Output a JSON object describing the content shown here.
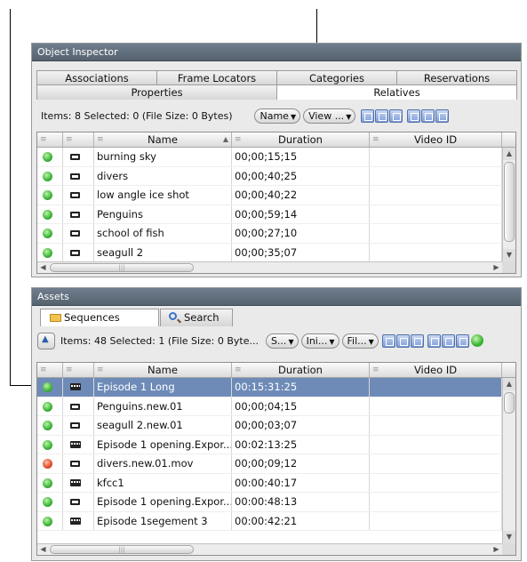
{
  "object_inspector": {
    "title": "Object Inspector",
    "tabs_top": [
      "Associations",
      "Frame Locators",
      "Categories",
      "Reservations"
    ],
    "tabs_bottom": [
      "Properties",
      "Relatives"
    ],
    "active_tab": "Relatives",
    "items_text": "Items: 8 Selected: 0 (File Size: 0 Bytes)",
    "dropdowns": [
      "Name",
      "View ..."
    ],
    "columns": [
      "",
      "",
      "Name",
      "Duration",
      "Video ID"
    ],
    "rows": [
      {
        "status": "green",
        "icon": "clip-icon",
        "name": "burning sky",
        "duration": "00;00;15;15",
        "video_id": ""
      },
      {
        "status": "green",
        "icon": "clip-icon",
        "name": "divers",
        "duration": "00;00;40;25",
        "video_id": ""
      },
      {
        "status": "green",
        "icon": "clip-icon",
        "name": "low angle ice shot",
        "duration": "00;00;40;22",
        "video_id": ""
      },
      {
        "status": "green",
        "icon": "clip-icon",
        "name": "Penguins",
        "duration": "00;00;59;14",
        "video_id": ""
      },
      {
        "status": "green",
        "icon": "clip-icon",
        "name": "school of fish",
        "duration": "00;00;27;10",
        "video_id": ""
      },
      {
        "status": "green",
        "icon": "clip-icon",
        "name": "seagull 2",
        "duration": "00;00;35;07",
        "video_id": ""
      }
    ]
  },
  "assets": {
    "title": "Assets",
    "tabs": [
      "Sequences",
      "Search"
    ],
    "active_tab": "Sequences",
    "items_text": "Items: 48 Selected: 1 (File Size: 0 Byte...",
    "dropdowns": [
      "S...",
      "Ini...",
      "Fil..."
    ],
    "columns": [
      "",
      "",
      "Name",
      "Duration",
      "Video ID"
    ],
    "rows": [
      {
        "status": "green",
        "icon": "sequence-icon",
        "name": "Episode 1 Long",
        "duration": "00:15:31:25",
        "video_id": "",
        "selected": true
      },
      {
        "status": "green",
        "icon": "clip-icon",
        "name": "Penguins.new.01",
        "duration": "00;00;04;15",
        "video_id": ""
      },
      {
        "status": "green",
        "icon": "clip-icon",
        "name": "seagull 2.new.01",
        "duration": "00;00;03;07",
        "video_id": ""
      },
      {
        "status": "green",
        "icon": "sequence-icon",
        "name": "Episode 1 opening.Expor...",
        "duration": "00:02:13:25",
        "video_id": ""
      },
      {
        "status": "red",
        "icon": "clip-icon",
        "name": "divers.new.01.mov",
        "duration": "00;00;09;12",
        "video_id": ""
      },
      {
        "status": "green",
        "icon": "sequence-icon",
        "name": "kfcc1",
        "duration": "00:00:40:17",
        "video_id": ""
      },
      {
        "status": "green",
        "icon": "clip-icon",
        "name": "Episode 1 opening.Expor...",
        "duration": "00:00:48:13",
        "video_id": ""
      },
      {
        "status": "green",
        "icon": "sequence-icon",
        "name": "Episode 1segement 3",
        "duration": "00:00:42:21",
        "video_id": ""
      }
    ]
  }
}
